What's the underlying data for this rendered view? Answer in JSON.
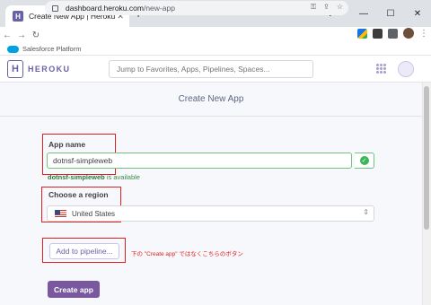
{
  "browser": {
    "tab_title": "Create New App | Heroku",
    "tab_favicon_letter": "H",
    "url_host": "dashboard.heroku.com",
    "url_path": "/new-app"
  },
  "salesforce_bar": {
    "label": "Salesforce Platform"
  },
  "header": {
    "logo_letter": "H",
    "logo_text": "HEROKU",
    "search_placeholder": "Jump to Favorites, Apps, Pipelines, Spaces..."
  },
  "page": {
    "title": "Create New App",
    "app_name_label": "App name",
    "app_name_value": "dotnsf-simpleweb",
    "availability_name": "dotnsf-simpleweb",
    "availability_suffix": " is available",
    "region_label": "Choose a region",
    "region_value": "United States",
    "pipeline_button": "Add to pipeline...",
    "annotation": "下の \"Create app\" ではなくこちらのボタン",
    "create_button": "Create app"
  },
  "colors": {
    "heroku_purple": "#79589f",
    "highlight_red": "#e02020",
    "success_green": "#3bb55a"
  }
}
